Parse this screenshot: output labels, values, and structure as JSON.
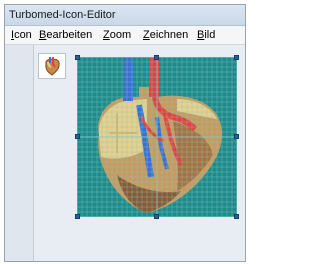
{
  "window": {
    "title": "Turbomed-Icon-Editor"
  },
  "menu": {
    "items": [
      {
        "label_acc": "I",
        "label_rest": "con"
      },
      {
        "label_acc": "B",
        "label_rest": "earbeiten"
      },
      {
        "label_acc": "Z",
        "label_rest": "oom"
      },
      {
        "label_acc": "Z",
        "label_rest": "eichnen"
      },
      {
        "label_acc": "B",
        "label_rest": "ild"
      }
    ]
  },
  "colors": {
    "grid_bg": "#1f8a8a",
    "grid_line": "#7fc9c9",
    "heart_light": "#e9d08a",
    "heart_mid": "#c99a5b",
    "heart_dark": "#8a5a35",
    "vessel_blue": "#3a6fd1",
    "vessel_red": "#e2413f",
    "handle": "#2d5e96"
  },
  "icons": {
    "preview": "heart-icon",
    "editor_canvas": "heart-pixel-art"
  }
}
